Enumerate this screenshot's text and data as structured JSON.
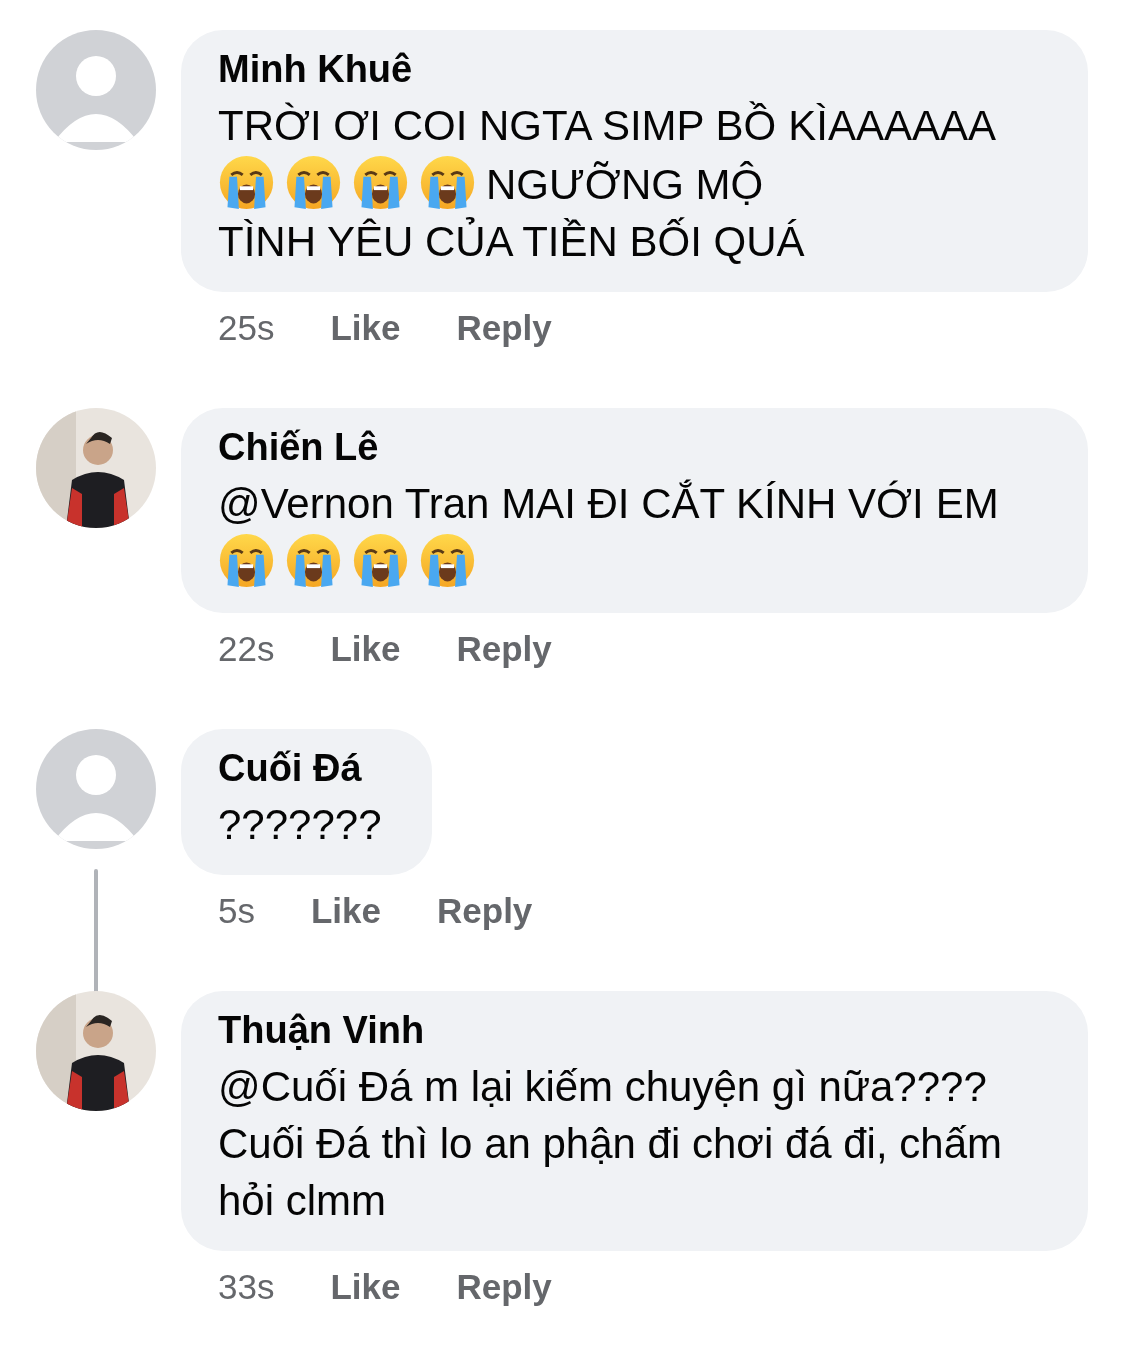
{
  "comments": [
    {
      "author": "Minh Khuê",
      "avatar": {
        "kind": "silhouette"
      },
      "thread_line": false,
      "body": [
        {
          "kind": "text",
          "text": "TRỜI ƠI COI NGTA SIMP BỒ"
        },
        {
          "kind": "text",
          "text": "KÌAAAAAA"
        },
        {
          "kind": "emoji"
        },
        {
          "kind": "emoji"
        },
        {
          "kind": "emoji"
        },
        {
          "kind": "emoji"
        },
        {
          "kind": "text",
          "text": "NGƯỠNG MỘ"
        },
        {
          "kind": "text",
          "text": "TÌNH YÊU CỦA TIỀN BỐI QUÁ"
        }
      ],
      "time": "25s",
      "actions": [
        "Like",
        "Reply"
      ]
    },
    {
      "author": "Chiến Lê",
      "avatar": {
        "kind": "picture"
      },
      "thread_line": false,
      "body": [
        {
          "kind": "text",
          "text": "@Vernon Tran MAI ĐI CẮT KÍNH VỚI"
        },
        {
          "kind": "text",
          "text": "EM"
        },
        {
          "kind": "emoji"
        },
        {
          "kind": "emoji"
        },
        {
          "kind": "emoji"
        },
        {
          "kind": "emoji"
        }
      ],
      "time": "22s",
      "actions": [
        "Like",
        "Reply"
      ]
    },
    {
      "author": "Cuối Đá",
      "avatar": {
        "kind": "silhouette"
      },
      "thread_line": true,
      "body": [
        {
          "kind": "text",
          "text": "???????"
        }
      ],
      "time": "5s",
      "actions": [
        "Like",
        "Reply"
      ]
    },
    {
      "author": "Thuận Vinh",
      "avatar": {
        "kind": "picture"
      },
      "thread_line": false,
      "body": [
        {
          "kind": "text",
          "text": "@Cuối Đá m lại kiếm chuyện gì nữa???? Cuối Đá thì lo an phận đi chơi đá đi, chấm hỏi clmm"
        }
      ],
      "time": "33s",
      "actions": [
        "Like",
        "Reply"
      ]
    }
  ]
}
